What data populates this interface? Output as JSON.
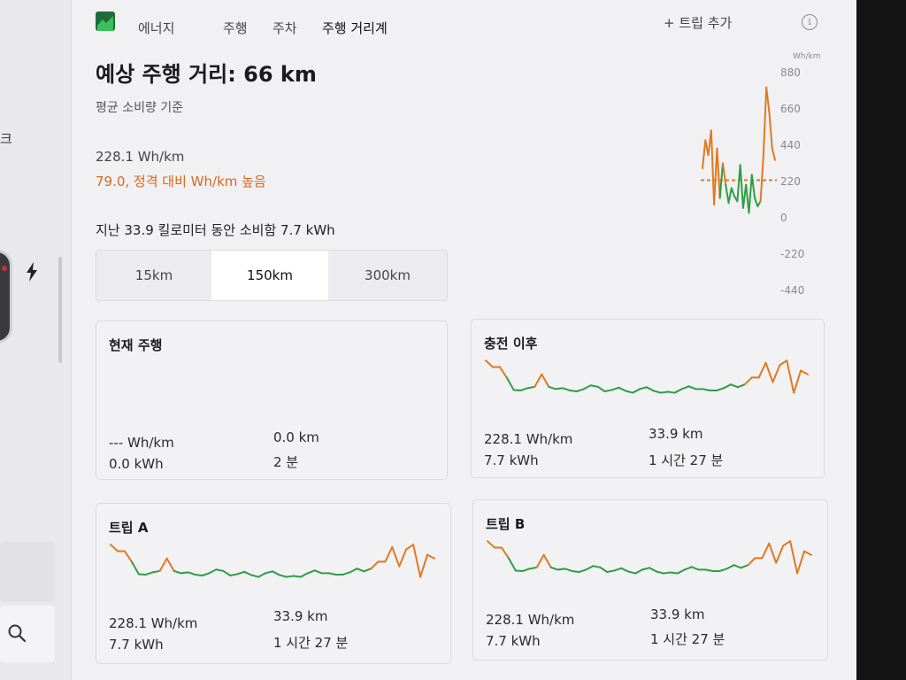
{
  "nav": {
    "title": "에너지",
    "tabs": [
      "주행",
      "주차",
      "주행 거리계"
    ],
    "active_tab": "주행 거리계",
    "add_trip": "+ 트립 추가"
  },
  "left_partial": "크",
  "headline": "예상 주행 거리: 66 km",
  "subtitle": "평균 소비량 기준",
  "consumption": "228.1 Wh/km",
  "comparison": "79.0, 정격 대비 Wh/km 높음",
  "summary": "지난 33.9 킬로미터 동안 소비함 7.7 kWh",
  "segments": [
    "15km",
    "150km",
    "300km"
  ],
  "active_segment": "150km",
  "chart_data": {
    "type": "line",
    "unit": "Wh/km",
    "ylim": [
      -440,
      880
    ],
    "y_ticks": [
      "880",
      "660",
      "440",
      "220",
      "0",
      "-220",
      "-440"
    ],
    "reference_line": 228.1,
    "colors": {
      "above_reference": "#e07a1f",
      "below_reference": "#2f9e44",
      "reference": "#e07a1f"
    },
    "series": [
      {
        "values": [
          300,
          470,
          380,
          530,
          80,
          420,
          120,
          330,
          200,
          90,
          180,
          130,
          100,
          320,
          60,
          200,
          30,
          260,
          120,
          70,
          100,
          380,
          790,
          640,
          420,
          350
        ]
      }
    ]
  },
  "cards": {
    "current": {
      "title": "현재 주행",
      "wh": "--- Wh/km",
      "kwh": "0.0 kWh",
      "dist": "0.0 km",
      "time": "2 분"
    },
    "since_charge": {
      "title": "충전 이후",
      "wh": "228.1 Wh/km",
      "kwh": "7.7 kWh",
      "dist": "33.9 km",
      "time": "1 시간 27 분"
    },
    "trip_a": {
      "title": "트립 A",
      "wh": "228.1 Wh/km",
      "kwh": "7.7 kWh",
      "dist": "33.9 km",
      "time": "1 시간 27 분"
    },
    "trip_b": {
      "title": "트립 B",
      "wh": "228.1 Wh/km",
      "kwh": "7.7 kWh",
      "dist": "33.9 km",
      "time": "1 시간 27 분"
    }
  },
  "mini_chart": {
    "values": [
      0.92,
      0.78,
      0.78,
      0.55,
      0.28,
      0.27,
      0.32,
      0.35,
      0.62,
      0.35,
      0.3,
      0.32,
      0.27,
      0.25,
      0.3,
      0.38,
      0.35,
      0.25,
      0.28,
      0.33,
      0.26,
      0.22,
      0.3,
      0.34,
      0.26,
      0.22,
      0.24,
      0.22,
      0.3,
      0.36,
      0.3,
      0.3,
      0.27,
      0.27,
      0.32,
      0.4,
      0.34,
      0.4,
      0.55,
      0.55,
      0.87,
      0.45,
      0.82,
      0.92,
      0.22,
      0.7,
      0.62
    ],
    "threshold": 0.45
  }
}
